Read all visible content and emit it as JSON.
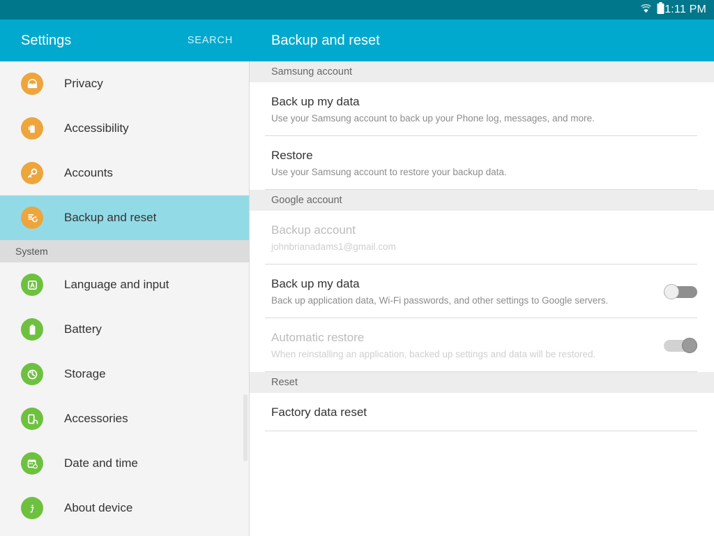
{
  "status_bar": {
    "time": "1:11 PM",
    "icons": [
      "wifi-icon",
      "battery-icon"
    ]
  },
  "sidebar": {
    "title": "Settings",
    "search_label": "SEARCH",
    "items": [
      {
        "label": "Privacy",
        "icon": "privacy-icon",
        "color": "orange",
        "selected": false,
        "type": "item"
      },
      {
        "label": "Accessibility",
        "icon": "accessibility-icon",
        "color": "orange",
        "selected": false,
        "type": "item"
      },
      {
        "label": "Accounts",
        "icon": "key-icon",
        "color": "orange",
        "selected": false,
        "type": "item"
      },
      {
        "label": "Backup and reset",
        "icon": "backup-reset-icon",
        "color": "orange",
        "selected": true,
        "type": "item"
      },
      {
        "label": "System",
        "type": "section"
      },
      {
        "label": "Language and input",
        "icon": "language-icon",
        "color": "green",
        "selected": false,
        "type": "item"
      },
      {
        "label": "Battery",
        "icon": "battery-icon",
        "color": "green",
        "selected": false,
        "type": "item"
      },
      {
        "label": "Storage",
        "icon": "storage-icon",
        "color": "green",
        "selected": false,
        "type": "item"
      },
      {
        "label": "Accessories",
        "icon": "accessories-icon",
        "color": "green",
        "selected": false,
        "type": "item"
      },
      {
        "label": "Date and time",
        "icon": "date-time-icon",
        "color": "green",
        "selected": false,
        "type": "item"
      },
      {
        "label": "About device",
        "icon": "info-icon",
        "color": "green",
        "selected": false,
        "type": "item"
      }
    ]
  },
  "panel": {
    "title": "Backup and reset",
    "sections": [
      {
        "header": "Samsung account",
        "rows": [
          {
            "title": "Back up my data",
            "subtitle": "Use your Samsung account to back up your Phone log, messages, and more.",
            "toggle": null,
            "disabled": false
          },
          {
            "title": "Restore",
            "subtitle": "Use your Samsung account to restore your backup data.",
            "toggle": null,
            "disabled": false
          }
        ]
      },
      {
        "header": "Google account",
        "rows": [
          {
            "title": "Backup account",
            "subtitle": "johnbrianadams1@gmail.com",
            "toggle": null,
            "disabled": true
          },
          {
            "title": "Back up my data",
            "subtitle": "Back up application data, Wi-Fi passwords, and other settings to Google servers.",
            "toggle": "off",
            "disabled": false
          },
          {
            "title": "Automatic restore",
            "subtitle": "When reinstalling an application, backed up settings and data will be restored.",
            "toggle": "on-disabled",
            "disabled": true
          }
        ]
      },
      {
        "header": "Reset",
        "rows": [
          {
            "title": "Factory data reset",
            "subtitle": null,
            "toggle": null,
            "disabled": false
          }
        ]
      }
    ]
  },
  "colors": {
    "status_bar": "#00778b",
    "app_bar": "#00a9cd",
    "selected_row": "#92dbe6",
    "section_header_sidebar": "#dcdcdc",
    "section_header_panel": "#ededed",
    "icon_orange": "#eda53c",
    "icon_green": "#6ec13f"
  }
}
